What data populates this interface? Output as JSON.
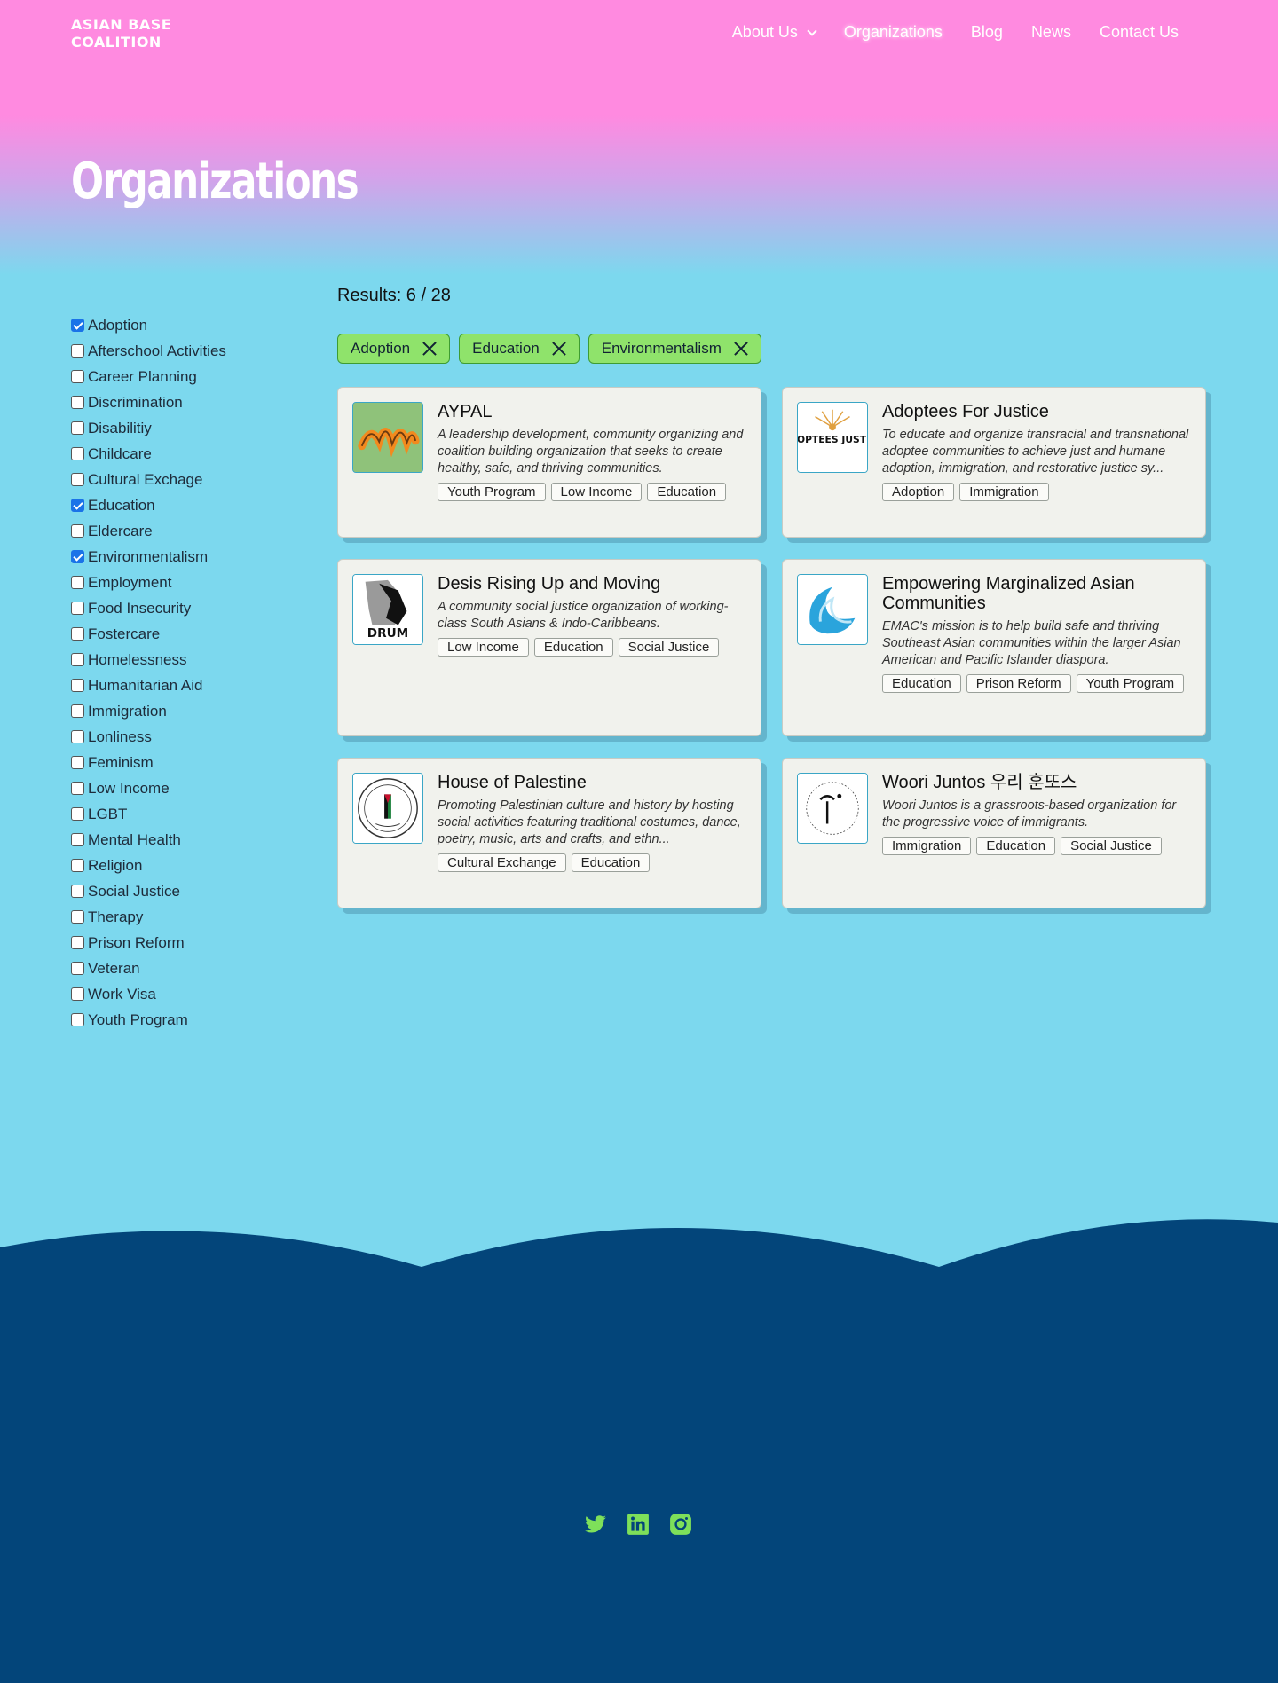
{
  "header": {
    "logo": "ASIAN BASE\nCOALITION",
    "nav": [
      {
        "label": "About Us",
        "dropdown": true,
        "active": false
      },
      {
        "label": "Organizations",
        "dropdown": false,
        "active": true
      },
      {
        "label": "Blog",
        "dropdown": false,
        "active": false
      },
      {
        "label": "News",
        "dropdown": false,
        "active": false
      },
      {
        "label": "Contact Us",
        "dropdown": false,
        "active": false
      }
    ]
  },
  "page": {
    "title": "Organizations"
  },
  "filters": [
    {
      "label": "Adoption",
      "checked": true
    },
    {
      "label": "Afterschool Activities",
      "checked": false
    },
    {
      "label": "Career Planning",
      "checked": false
    },
    {
      "label": "Discrimination",
      "checked": false
    },
    {
      "label": "Disabilitiy",
      "checked": false
    },
    {
      "label": "Childcare",
      "checked": false
    },
    {
      "label": "Cultural Exchage",
      "checked": false
    },
    {
      "label": "Education",
      "checked": true
    },
    {
      "label": "Eldercare",
      "checked": false
    },
    {
      "label": "Environmentalism",
      "checked": true
    },
    {
      "label": "Employment",
      "checked": false
    },
    {
      "label": "Food Insecurity",
      "checked": false
    },
    {
      "label": "Fostercare",
      "checked": false
    },
    {
      "label": "Homelessness",
      "checked": false
    },
    {
      "label": "Humanitarian Aid",
      "checked": false
    },
    {
      "label": "Immigration",
      "checked": false
    },
    {
      "label": "Lonliness",
      "checked": false
    },
    {
      "label": "Feminism",
      "checked": false
    },
    {
      "label": "Low Income",
      "checked": false
    },
    {
      "label": "LGBT",
      "checked": false
    },
    {
      "label": "Mental Health",
      "checked": false
    },
    {
      "label": "Religion",
      "checked": false
    },
    {
      "label": "Social Justice",
      "checked": false
    },
    {
      "label": "Therapy",
      "checked": false
    },
    {
      "label": "Prison Reform",
      "checked": false
    },
    {
      "label": "Veteran",
      "checked": false
    },
    {
      "label": "Work Visa",
      "checked": false
    },
    {
      "label": "Youth Program",
      "checked": false
    }
  ],
  "results": {
    "label": "Results: 6 / 28"
  },
  "active_chips": [
    "Adoption",
    "Education",
    "Environmentalism"
  ],
  "orgs": [
    {
      "name": "AYPAL",
      "logo": "aypal-logo",
      "desc": "A leadership development, community organizing and coalition building organization that seeks to create healthy, safe, and thriving communities.",
      "tags": [
        "Youth Program",
        "Low Income",
        "Education"
      ]
    },
    {
      "name": "Adoptees For Justice",
      "logo": "adoptees-logo",
      "logo_text": "ADOPTEES JUSTICE",
      "desc": "To educate and organize transracial and transnational adoptee communities to achieve just and humane adoption, immigration, and restorative justice sy...",
      "tags": [
        "Adoption",
        "Immigration"
      ]
    },
    {
      "name": "Desis Rising Up and Moving",
      "logo": "drum-logo",
      "logo_text": "DRUM",
      "desc": "A community social justice organization of working-class South Asians & Indo-Caribbeans.",
      "tags": [
        "Low Income",
        "Education",
        "Social Justice"
      ]
    },
    {
      "name": "Empowering Marginalized Asian Communities",
      "logo": "wave-logo",
      "desc": "EMAC's mission is to help build safe and thriving Southeast Asian communities within the larger Asian American and Pacific Islander diaspora.",
      "tags": [
        "Education",
        "Prison Reform",
        "Youth Program"
      ]
    },
    {
      "name": "House of Palestine",
      "logo": "palestine-seal-logo",
      "desc": "Promoting Palestinian culture and history by hosting social activities featuring traditional costumes, dance, poetry, music, arts and crafts, and ethn...",
      "tags": [
        "Cultural Exchange",
        "Education"
      ]
    },
    {
      "name": "Woori Juntos 우리 훈또스",
      "logo": "woori-juntos-logo",
      "desc": "Woori Juntos is a grassroots-based organization for the progressive voice of immigrants.",
      "tags": [
        "Immigration",
        "Education",
        "Social Justice"
      ]
    }
  ],
  "footer": {
    "social": [
      "twitter-icon",
      "linkedin-icon",
      "instagram-icon"
    ],
    "accent_color": "#7ee05a",
    "bg_color": "#03457a"
  }
}
